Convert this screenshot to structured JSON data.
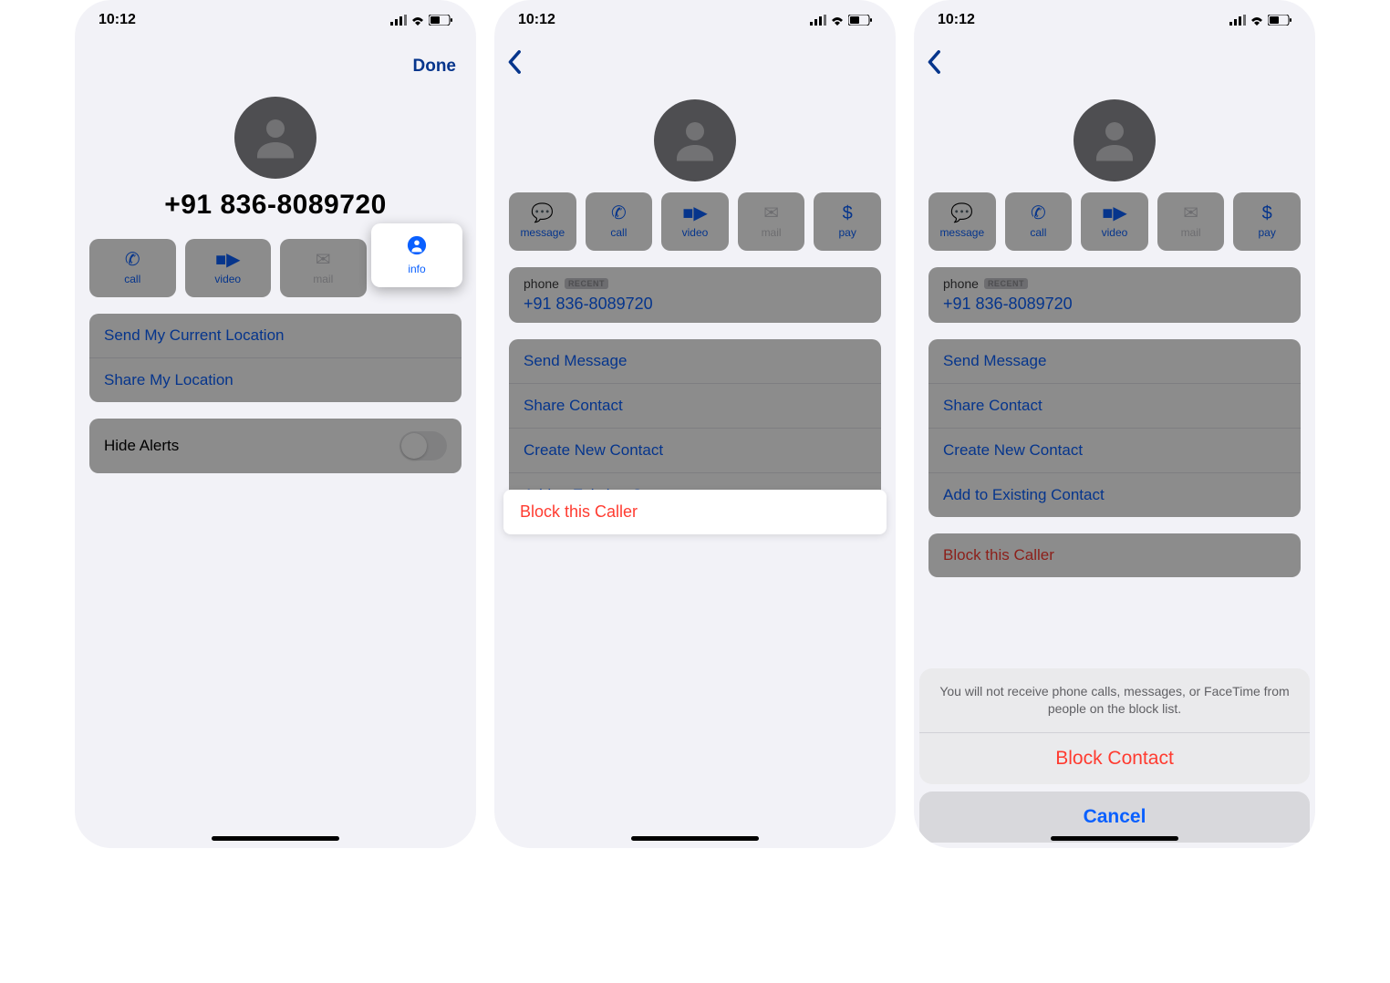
{
  "status": {
    "time": "10:12"
  },
  "panel1": {
    "done": "Done",
    "phone_number": "+91 836-8089720",
    "actions": {
      "call": "call",
      "video": "video",
      "mail": "mail",
      "info": "info"
    },
    "location_rows": [
      "Send My Current Location",
      "Share My Location"
    ],
    "hide_alerts": "Hide Alerts"
  },
  "panel2": {
    "phone_label": "phone",
    "recent_badge": "RECENT",
    "phone_number": "+91 836-8089720",
    "actions": {
      "message": "message",
      "call": "call",
      "video": "video",
      "mail": "mail",
      "pay": "pay"
    },
    "contact_rows": [
      "Send Message",
      "Share Contact",
      "Create New Contact",
      "Add to Existing Contact"
    ],
    "block_row": "Block this Caller"
  },
  "panel3": {
    "phone_label": "phone",
    "recent_badge": "RECENT",
    "phone_number": "+91 836-8089720",
    "actions": {
      "message": "message",
      "call": "call",
      "video": "video",
      "mail": "mail",
      "pay": "pay"
    },
    "contact_rows": [
      "Send Message",
      "Share Contact",
      "Create New Contact",
      "Add to Existing Contact"
    ],
    "block_row": "Block this Caller",
    "sheet": {
      "message": "You will not receive phone calls, messages, or FaceTime from people on the block list.",
      "block": "Block Contact",
      "cancel": "Cancel"
    }
  }
}
